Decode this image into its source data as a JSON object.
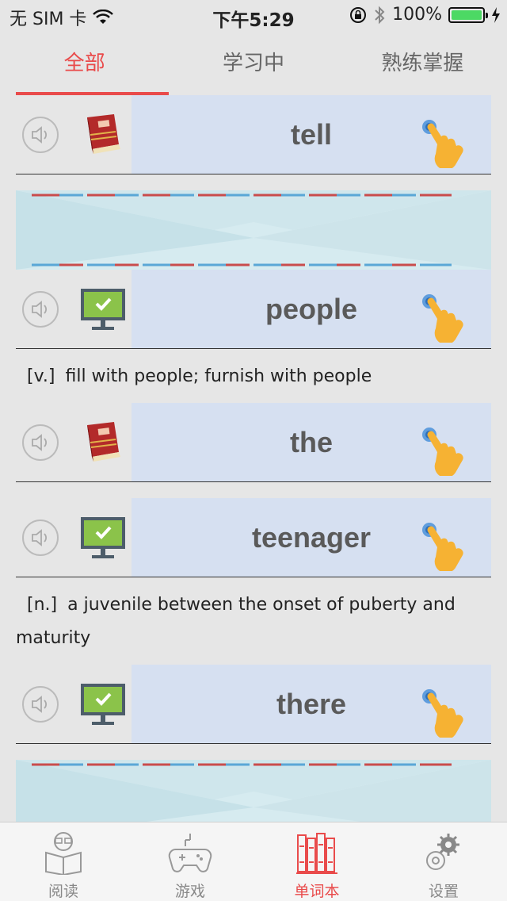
{
  "status": {
    "carrier": "无 SIM 卡",
    "time": "下午5:29",
    "battery": "100%"
  },
  "tabs": [
    {
      "label": "全部",
      "active": true
    },
    {
      "label": "学习中",
      "active": false
    },
    {
      "label": "熟练掌握",
      "active": false
    }
  ],
  "words": [
    {
      "word": "tell",
      "thumb": "book-icon",
      "definition": null
    },
    {
      "word": "people",
      "thumb": "monitor-check-icon",
      "pos": "[v.]",
      "definition": "fill with people; furnish with people"
    },
    {
      "word": "the",
      "thumb": "book-icon",
      "definition": null
    },
    {
      "word": "teenager",
      "thumb": "monitor-check-icon",
      "pos": "[n.]",
      "definition": "a juvenile between the onset of puberty and maturity"
    },
    {
      "word": "there",
      "thumb": "monitor-check-icon",
      "definition": null
    }
  ],
  "tabbar": [
    {
      "label": "阅读",
      "icon": "reading-icon",
      "active": false
    },
    {
      "label": "游戏",
      "icon": "gamepad-icon",
      "active": false
    },
    {
      "label": "单词本",
      "icon": "bookshelf-icon",
      "active": true
    },
    {
      "label": "设置",
      "icon": "gear-icon",
      "active": false
    }
  ],
  "colors": {
    "accent": "#e94b4b",
    "word_bg": "#d6e0f1",
    "page_bg": "#e6e6e6"
  }
}
